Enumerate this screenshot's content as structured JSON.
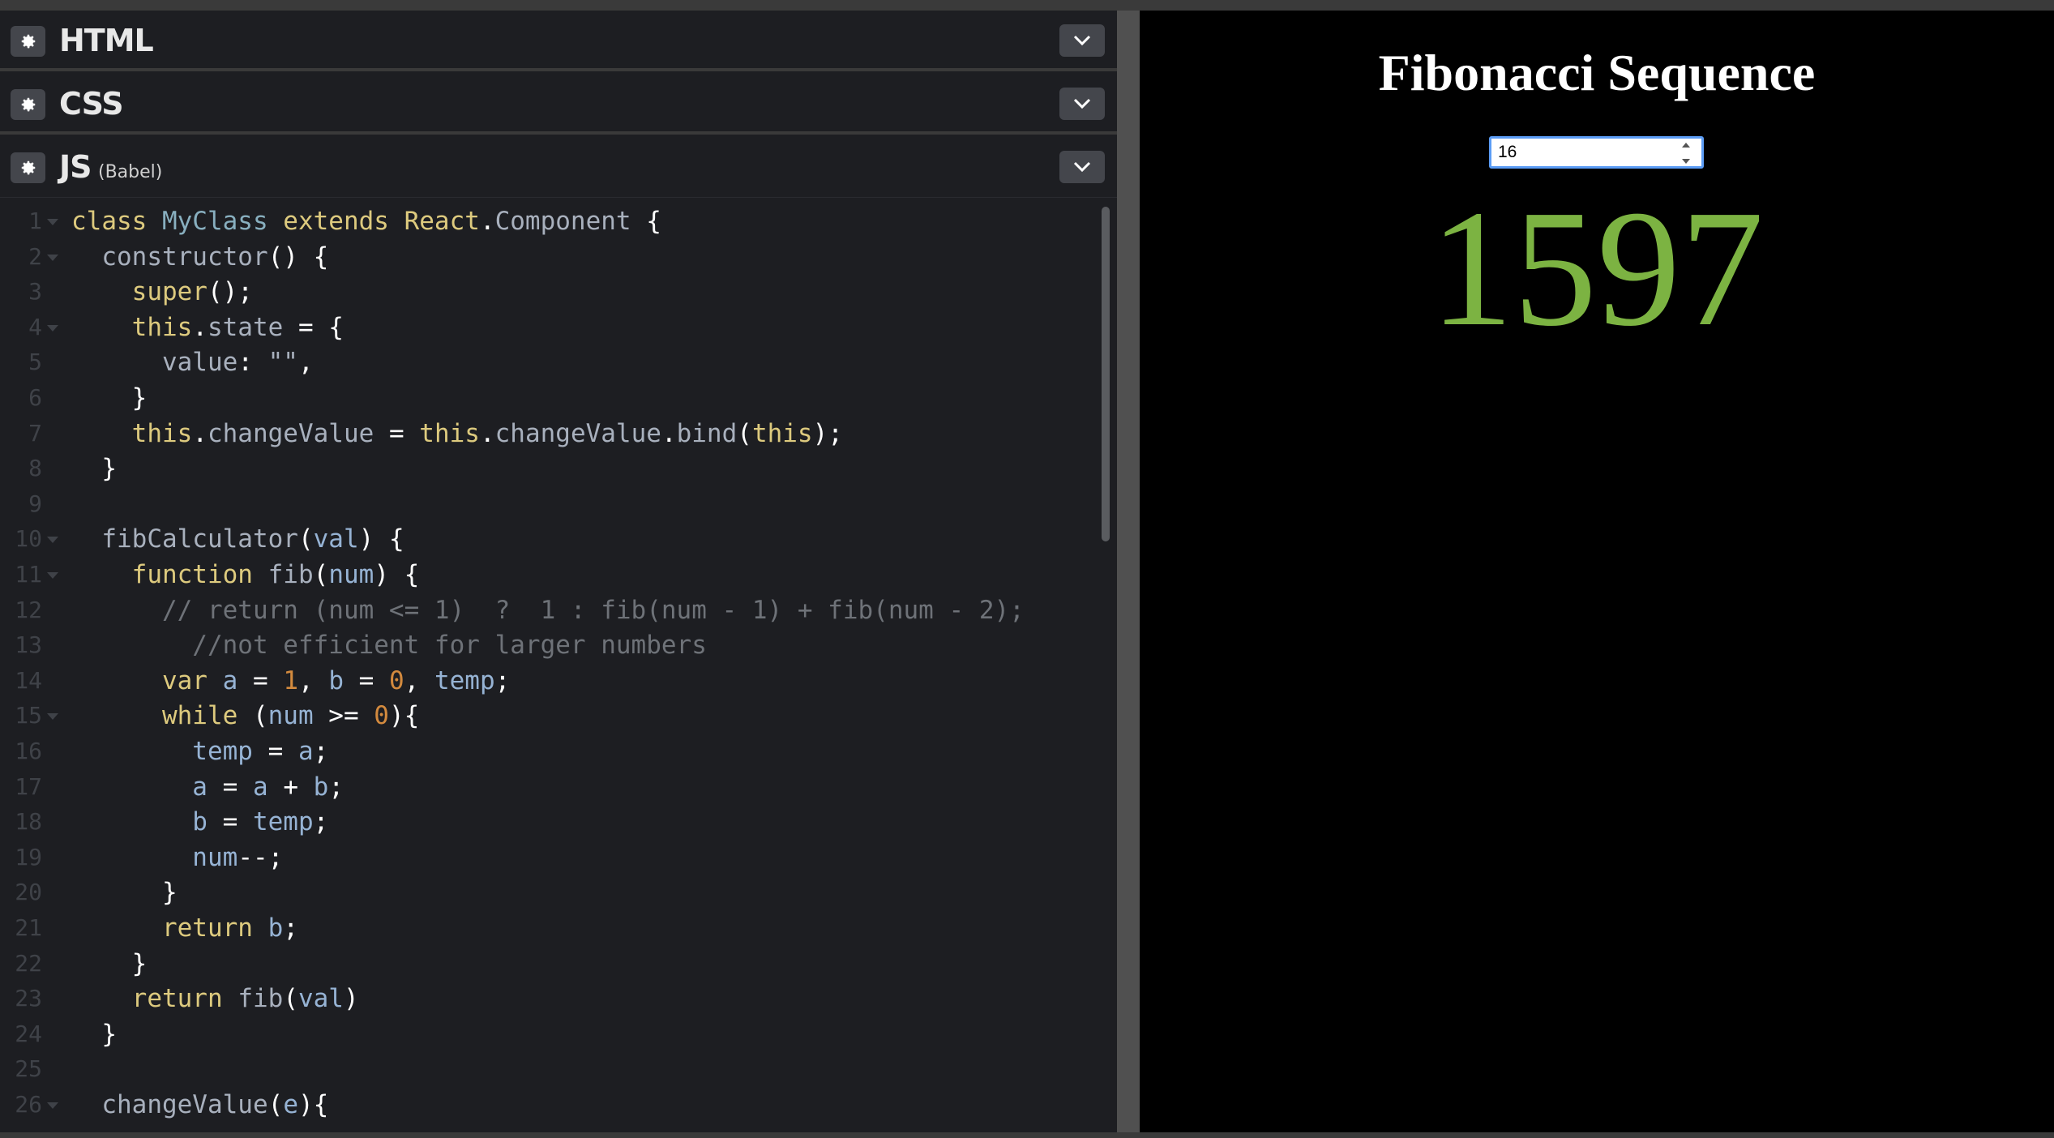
{
  "editor": {
    "panels": [
      {
        "title": "HTML",
        "subtitle": ""
      },
      {
        "title": "CSS",
        "subtitle": ""
      },
      {
        "title": "JS",
        "subtitle": "(Babel)"
      }
    ],
    "code_lines": [
      {
        "n": "1",
        "fold": true,
        "tokens": [
          [
            "kw",
            "class "
          ],
          [
            "cls",
            "MyClass "
          ],
          [
            "kw",
            "extends "
          ],
          [
            "kw",
            "React"
          ],
          [
            "pn",
            "."
          ],
          [
            "fn",
            "Component"
          ],
          [
            "pn",
            " {"
          ]
        ]
      },
      {
        "n": "2",
        "fold": true,
        "tokens": [
          [
            "fn",
            "  constructor"
          ],
          [
            "pn",
            "() {"
          ]
        ]
      },
      {
        "n": "3",
        "fold": false,
        "tokens": [
          [
            "kw",
            "    super"
          ],
          [
            "pn",
            "();"
          ]
        ]
      },
      {
        "n": "4",
        "fold": true,
        "tokens": [
          [
            "kw",
            "    this"
          ],
          [
            "pn",
            "."
          ],
          [
            "fn",
            "state"
          ],
          [
            "pn",
            " = {"
          ]
        ]
      },
      {
        "n": "5",
        "fold": false,
        "tokens": [
          [
            "fn",
            "      value"
          ],
          [
            "pn",
            ": "
          ],
          [
            "fn",
            "\"\""
          ],
          [
            "pn",
            ","
          ]
        ]
      },
      {
        "n": "6",
        "fold": false,
        "tokens": [
          [
            "pn",
            "    }"
          ]
        ]
      },
      {
        "n": "7",
        "fold": false,
        "tokens": [
          [
            "kw",
            "    this"
          ],
          [
            "pn",
            "."
          ],
          [
            "fn",
            "changeValue"
          ],
          [
            "pn",
            " = "
          ],
          [
            "kw",
            "this"
          ],
          [
            "pn",
            "."
          ],
          [
            "fn",
            "changeValue"
          ],
          [
            "pn",
            "."
          ],
          [
            "fn",
            "bind"
          ],
          [
            "pn",
            "("
          ],
          [
            "kw",
            "this"
          ],
          [
            "pn",
            ");"
          ]
        ]
      },
      {
        "n": "8",
        "fold": false,
        "tokens": [
          [
            "pn",
            "  }"
          ]
        ]
      },
      {
        "n": "9",
        "fold": false,
        "tokens": []
      },
      {
        "n": "10",
        "fold": true,
        "tokens": [
          [
            "fn",
            "  fibCalculator"
          ],
          [
            "pn",
            "("
          ],
          [
            "vr",
            "val"
          ],
          [
            "pn",
            ") {"
          ]
        ]
      },
      {
        "n": "11",
        "fold": true,
        "tokens": [
          [
            "kw",
            "    function "
          ],
          [
            "fn",
            "fib"
          ],
          [
            "pn",
            "("
          ],
          [
            "vr",
            "num"
          ],
          [
            "pn",
            ") {"
          ]
        ]
      },
      {
        "n": "12",
        "fold": false,
        "tokens": [
          [
            "cm",
            "      // return (num <= 1)  ?  1 : fib(num - 1) + fib(num - 2);"
          ]
        ]
      },
      {
        "n": "13",
        "fold": false,
        "tokens": [
          [
            "cm",
            "        //not efficient for larger numbers"
          ]
        ]
      },
      {
        "n": "14",
        "fold": false,
        "tokens": [
          [
            "kw",
            "      var "
          ],
          [
            "vr",
            "a"
          ],
          [
            "pn",
            " = "
          ],
          [
            "num",
            "1"
          ],
          [
            "pn",
            ", "
          ],
          [
            "vr",
            "b"
          ],
          [
            "pn",
            " = "
          ],
          [
            "num",
            "0"
          ],
          [
            "pn",
            ", "
          ],
          [
            "vr",
            "temp"
          ],
          [
            "pn",
            ";"
          ]
        ]
      },
      {
        "n": "15",
        "fold": true,
        "tokens": [
          [
            "kw",
            "      while "
          ],
          [
            "pn",
            "("
          ],
          [
            "vr",
            "num"
          ],
          [
            "pn",
            " >= "
          ],
          [
            "num",
            "0"
          ],
          [
            "pn",
            "){"
          ]
        ]
      },
      {
        "n": "16",
        "fold": false,
        "tokens": [
          [
            "vr",
            "        temp"
          ],
          [
            "pn",
            " = "
          ],
          [
            "vr",
            "a"
          ],
          [
            "pn",
            ";"
          ]
        ]
      },
      {
        "n": "17",
        "fold": false,
        "tokens": [
          [
            "vr",
            "        a"
          ],
          [
            "pn",
            " = "
          ],
          [
            "vr",
            "a"
          ],
          [
            "pn",
            " + "
          ],
          [
            "vr",
            "b"
          ],
          [
            "pn",
            ";"
          ]
        ]
      },
      {
        "n": "18",
        "fold": false,
        "tokens": [
          [
            "vr",
            "        b"
          ],
          [
            "pn",
            " = "
          ],
          [
            "vr",
            "temp"
          ],
          [
            "pn",
            ";"
          ]
        ]
      },
      {
        "n": "19",
        "fold": false,
        "tokens": [
          [
            "vr",
            "        num"
          ],
          [
            "pn",
            "--;"
          ]
        ]
      },
      {
        "n": "20",
        "fold": false,
        "tokens": [
          [
            "pn",
            "      }"
          ]
        ]
      },
      {
        "n": "21",
        "fold": false,
        "tokens": [
          [
            "kw",
            "      return "
          ],
          [
            "vr",
            "b"
          ],
          [
            "pn",
            ";"
          ]
        ]
      },
      {
        "n": "22",
        "fold": false,
        "tokens": [
          [
            "pn",
            "    }"
          ]
        ]
      },
      {
        "n": "23",
        "fold": false,
        "tokens": [
          [
            "kw",
            "    return "
          ],
          [
            "fn",
            "fib"
          ],
          [
            "pn",
            "("
          ],
          [
            "vr",
            "val"
          ],
          [
            "pn",
            ")"
          ]
        ]
      },
      {
        "n": "24",
        "fold": false,
        "tokens": [
          [
            "pn",
            "  }"
          ]
        ]
      },
      {
        "n": "25",
        "fold": false,
        "tokens": []
      },
      {
        "n": "26",
        "fold": true,
        "tokens": [
          [
            "fn",
            "  changeValue"
          ],
          [
            "pn",
            "("
          ],
          [
            "vr",
            "e"
          ],
          [
            "pn",
            "){"
          ]
        ]
      }
    ]
  },
  "preview": {
    "title": "Fibonacci Sequence",
    "input_value": "16",
    "result": "1597"
  },
  "colors": {
    "result_green": "#7cb342",
    "editor_bg": "#1d1e22",
    "input_focus": "#5b9cf5"
  }
}
